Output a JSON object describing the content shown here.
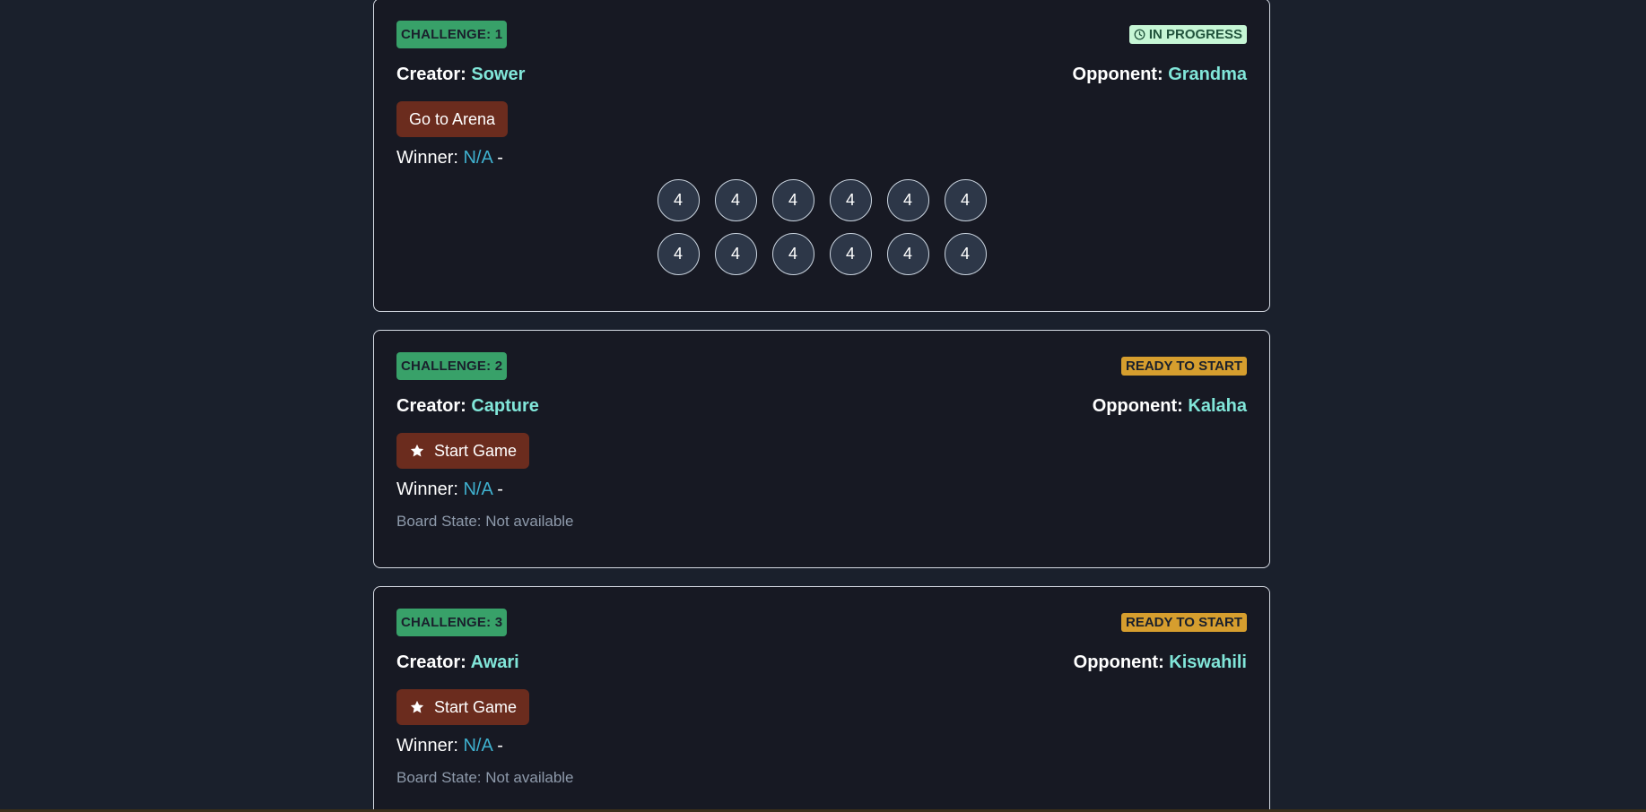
{
  "challenges": [
    {
      "badge": "CHALLENGE: 1",
      "status": "IN PROGRESS",
      "status_kind": "inprogress",
      "creator_label": "Creator:",
      "creator": "Sower",
      "opponent_label": "Opponent:",
      "opponent": "Grandma",
      "button_label": "Go to Arena",
      "winner_label": "Winner:",
      "winner": "N/A",
      "winner_suffix": "-",
      "board": {
        "top_row": [
          "4",
          "4",
          "4",
          "4",
          "4",
          "4"
        ],
        "bottom_row": [
          "4",
          "4",
          "4",
          "4",
          "4",
          "4"
        ]
      }
    },
    {
      "badge": "CHALLENGE: 2",
      "status": "READY TO START",
      "status_kind": "ready",
      "creator_label": "Creator:",
      "creator": "Capture",
      "opponent_label": "Opponent:",
      "opponent": "Kalaha",
      "button_label": "Start Game",
      "winner_label": "Winner:",
      "winner": "N/A",
      "winner_suffix": "-",
      "board_state": "Board State: Not available"
    },
    {
      "badge": "CHALLENGE: 3",
      "status": "READY TO START",
      "status_kind": "ready",
      "creator_label": "Creator:",
      "creator": "Awari",
      "opponent_label": "Opponent:",
      "opponent": "Kiswahili",
      "button_label": "Start Game",
      "winner_label": "Winner:",
      "winner": "N/A",
      "winner_suffix": "-",
      "board_state": "Board State: Not available"
    }
  ],
  "icons": {
    "status_in_progress": "clock-icon",
    "start_button": "star-icon"
  },
  "colors": {
    "background": "#1a202c",
    "card": "#171923",
    "challenge_badge": "#38a169",
    "in_progress_badge": "#c6f6d5",
    "ready_badge": "#d69e2e",
    "button": "#6b2c1e",
    "name": "#81e6d9",
    "winner_value": "#3fb1cf"
  }
}
